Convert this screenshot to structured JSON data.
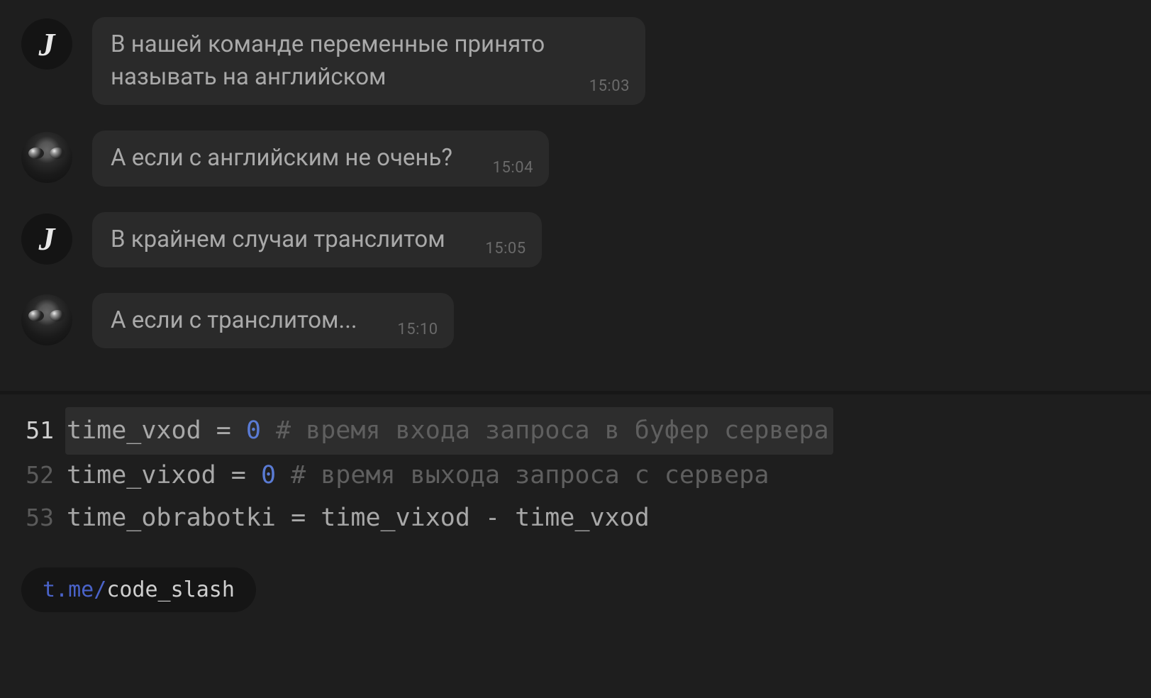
{
  "chat": {
    "messages": [
      {
        "avatar": "letter",
        "avatar_letter": "J",
        "text": "В нашей команде переменные принято называть на английском",
        "ts": "15:03",
        "wide": true
      },
      {
        "avatar": "goggles",
        "text": "А если с английским не очень?",
        "ts": "15:04",
        "wide": false
      },
      {
        "avatar": "letter",
        "avatar_letter": "J",
        "text": "В крайнем случаи транслитом",
        "ts": "15:05",
        "wide": false
      },
      {
        "avatar": "goggles",
        "text": "А если с транслитом...",
        "ts": "15:10",
        "wide": false
      }
    ]
  },
  "code": {
    "lines": [
      {
        "num": "51",
        "current": true,
        "var": "time_vxod",
        "op": " = ",
        "val": "0",
        "comment": " # время входа запроса в буфер сервера"
      },
      {
        "num": "52",
        "current": false,
        "var": "time_vixod",
        "op": " = ",
        "val": "0",
        "comment": " # время выхода запроса с сервера"
      },
      {
        "num": "53",
        "current": false,
        "var": "time_obrabotki",
        "op": " = ",
        "expr": "time_vixod - time_vxod"
      }
    ]
  },
  "link": {
    "domain": "t.me/",
    "path": "code_slash"
  }
}
